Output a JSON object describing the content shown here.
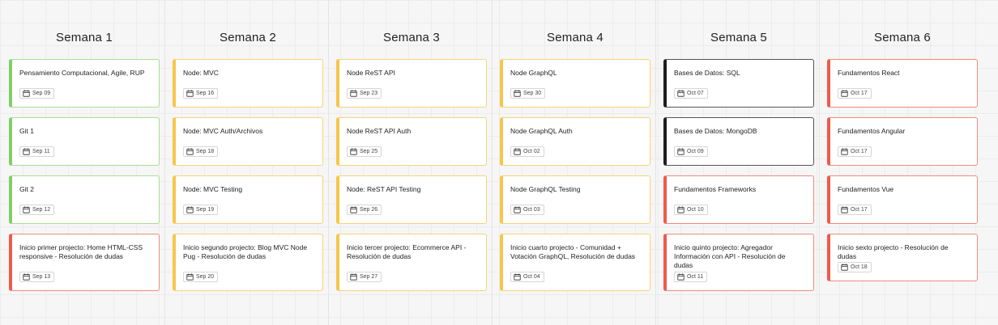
{
  "colors": {
    "green": "#7fcf63",
    "yellow": "#f7c64a",
    "black": "#1e1e1e",
    "red": "#ef5a4a"
  },
  "columns": [
    {
      "title": "Semana 1",
      "cards": [
        {
          "title": "Pensamiento Computacional, Agile, RUP",
          "date": "Sep 09",
          "color": "green",
          "icon": "calendar-icon"
        },
        {
          "title": "Git 1",
          "date": "Sep 11",
          "color": "green",
          "icon": "calendar-icon"
        },
        {
          "title": "Git 2",
          "date": "Sep 12",
          "color": "green",
          "icon": "calendar-icon"
        },
        {
          "title": "Inicio primer projecto: Home HTML-CSS responsive - Resolución de dudas",
          "date": "Sep 13",
          "color": "red",
          "icon": "calendar-icon"
        }
      ]
    },
    {
      "title": "Semana 2",
      "cards": [
        {
          "title": "Node: MVC",
          "date": "Sep 16",
          "color": "yellow",
          "icon": "calendar-icon"
        },
        {
          "title": "Node: MVC Auth/Archivos",
          "date": "Sep 18",
          "color": "yellow",
          "icon": "calendar-icon"
        },
        {
          "title": "Node: MVC Testing",
          "date": "Sep 19",
          "color": "yellow",
          "icon": "calendar-icon"
        },
        {
          "title": "Inicio segundo projecto: Blog MVC Node Pug - Resolución de dudas",
          "date": "Sep 20",
          "color": "yellow",
          "icon": "calendar-icon"
        }
      ]
    },
    {
      "title": "Semana 3",
      "cards": [
        {
          "title": "Node ReST API",
          "date": "Sep 23",
          "color": "yellow",
          "icon": "calendar-icon"
        },
        {
          "title": "Node ReST API Auth",
          "date": "Sep 25",
          "color": "yellow",
          "icon": "calendar-icon"
        },
        {
          "title": "Node: ReST API Testing",
          "date": "Sep 26",
          "color": "yellow",
          "icon": "calendar-icon"
        },
        {
          "title": "Inicio tercer projecto: Ecommerce API - Resolución de dudas",
          "date": "Sep 27",
          "color": "yellow",
          "icon": "calendar-icon"
        }
      ]
    },
    {
      "title": "Semana 4",
      "cards": [
        {
          "title": "Node GraphQL",
          "date": "Sep 30",
          "color": "yellow",
          "icon": "calendar-icon"
        },
        {
          "title": "Node GraphQL Auth",
          "date": "Oct 02",
          "color": "yellow",
          "icon": "calendar-icon"
        },
        {
          "title": "Node GraphQL Testing",
          "date": "Oct 03",
          "color": "yellow",
          "icon": "calendar-icon"
        },
        {
          "title": "Inicio cuarto projecto - Comunidad + Votación GraphQL, Resolución de dudas",
          "date": "Oct 04",
          "color": "yellow",
          "icon": "calendar-icon"
        }
      ]
    },
    {
      "title": "Semana 5",
      "cards": [
        {
          "title": "Bases de Datos: SQL",
          "date": "Oct 07",
          "color": "black",
          "icon": "calendar-icon"
        },
        {
          "title": "Bases de Datos: MongoDB",
          "date": "Oct 09",
          "color": "black",
          "icon": "calendar-icon"
        },
        {
          "title": "Fundamentos Frameworks",
          "date": "Oct 10",
          "color": "red",
          "icon": "calendar-icon"
        },
        {
          "title": "Inicio quinto projecto: Agregador Información con API - Resolución de dudas",
          "date": "Oct 11",
          "color": "red",
          "icon": "calendar-icon"
        }
      ]
    },
    {
      "title": "Semana 6",
      "cards": [
        {
          "title": "Fundamentos React",
          "date": "Oct 17",
          "color": "red",
          "icon": "calendar-icon"
        },
        {
          "title": "Fundamentos Angular",
          "date": "Oct 17",
          "color": "red",
          "icon": "calendar-icon"
        },
        {
          "title": "Fundamentos Vue",
          "date": "Oct 17",
          "color": "red",
          "icon": "calendar-icon"
        },
        {
          "title": "Inicio sexto projecto - Resolución de dudas",
          "date": "Oct 18",
          "color": "red",
          "icon": "calendar-icon"
        }
      ]
    }
  ]
}
